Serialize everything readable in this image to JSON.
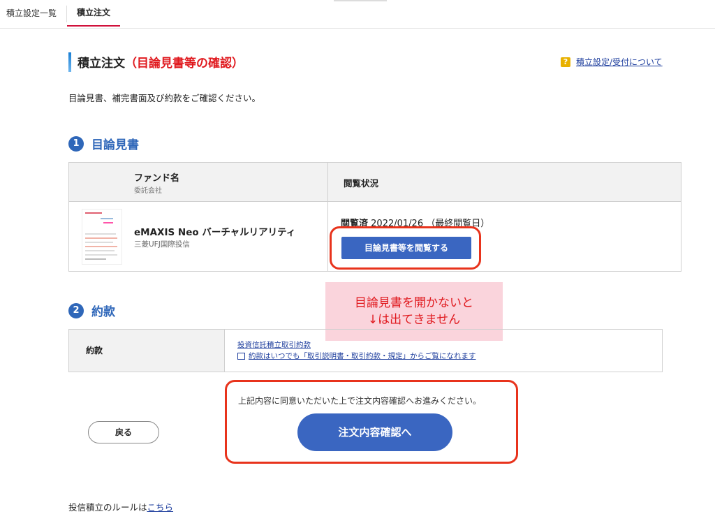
{
  "nav": {
    "tabs": [
      {
        "label": "積立設定一覧"
      },
      {
        "label": "積立注文"
      }
    ]
  },
  "header": {
    "title": "積立注文",
    "title_sub": "（目論見書等の確認）",
    "help_link": "積立設定/受付について"
  },
  "intro": "目論見書、補完書面及び約款をご確認ください。",
  "section1": {
    "number": "1",
    "title": "目論見書",
    "table": {
      "header_fund": "ファンド名",
      "header_company": "委託会社",
      "header_status": "閲覧状況",
      "fund_name": "eMAXIS Neo バーチャルリアリティ",
      "company": "三菱UFJ国際投信",
      "status_label": "閲覧済",
      "status_date": "2022/01/26 （最終閲覧日）",
      "view_button": "目論見書等を閲覧する"
    }
  },
  "annotation": {
    "line1": "目論見書を開かないと",
    "line2": "↓は出てきません"
  },
  "section2": {
    "number": "2",
    "title": "約款",
    "label": "約款",
    "link1": "投資信託積立取引約款",
    "link2": "約款はいつでも「取引説明書・取引約款・規定」からご覧になれます"
  },
  "actions": {
    "agree_text": "上記内容に同意いただいた上で注文内容確認へお進みください。",
    "confirm_button": "注文内容確認へ",
    "back_button": "戻る"
  },
  "footer": {
    "text": "投信積立のルールは",
    "link": "こちら"
  },
  "colors": {
    "accent_blue": "#3a66c1",
    "highlight_red": "#e8331c",
    "note_pink": "#fad4dc"
  }
}
